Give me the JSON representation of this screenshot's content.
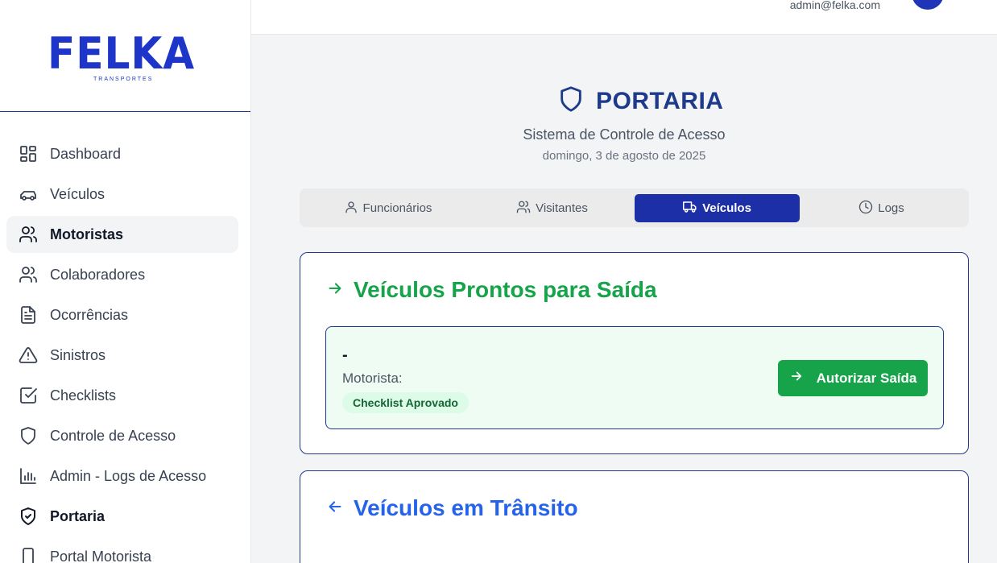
{
  "brand": {
    "name": "FELKA",
    "tagline": "TRANSPORTES",
    "color": "#1d35c9"
  },
  "header": {
    "user_email": "admin@felka.com"
  },
  "sidebar": {
    "items": [
      {
        "label": "Dashboard",
        "icon": "dashboard-icon"
      },
      {
        "label": "Veículos",
        "icon": "car-icon"
      },
      {
        "label": "Motoristas",
        "icon": "users-icon",
        "active": true
      },
      {
        "label": "Colaboradores",
        "icon": "users-icon"
      },
      {
        "label": "Ocorrências",
        "icon": "file-text-icon"
      },
      {
        "label": "Sinistros",
        "icon": "alert-triangle-icon"
      },
      {
        "label": "Checklists",
        "icon": "check-square-icon"
      },
      {
        "label": "Controle de Acesso",
        "icon": "shield-icon"
      },
      {
        "label": "Admin - Logs de Acesso",
        "icon": "bar-chart-icon"
      },
      {
        "label": "Portaria",
        "icon": "shield-check-icon"
      },
      {
        "label": "Portal Motorista",
        "icon": "smartphone-icon"
      }
    ]
  },
  "page": {
    "title": "PORTARIA",
    "subtitle": "Sistema de Controle de Acesso",
    "date": "domingo, 3 de agosto de 2025"
  },
  "tabs": [
    {
      "label": "Funcionários",
      "icon": "user-icon"
    },
    {
      "label": "Visitantes",
      "icon": "users-icon"
    },
    {
      "label": "Veículos",
      "icon": "truck-icon",
      "active": true
    },
    {
      "label": "Logs",
      "icon": "clock-icon"
    }
  ],
  "ready_section": {
    "title": "Veículos Prontos para Saída",
    "vehicle": {
      "plate": "-",
      "driver_label": "Motorista:",
      "status": "Checklist Aprovado"
    },
    "action_label": "Autorizar Saída"
  },
  "transit_section": {
    "title": "Veículos em Trânsito"
  },
  "colors": {
    "primary": "#1d2fa6",
    "success": "#16a34a",
    "info": "#2563eb"
  }
}
